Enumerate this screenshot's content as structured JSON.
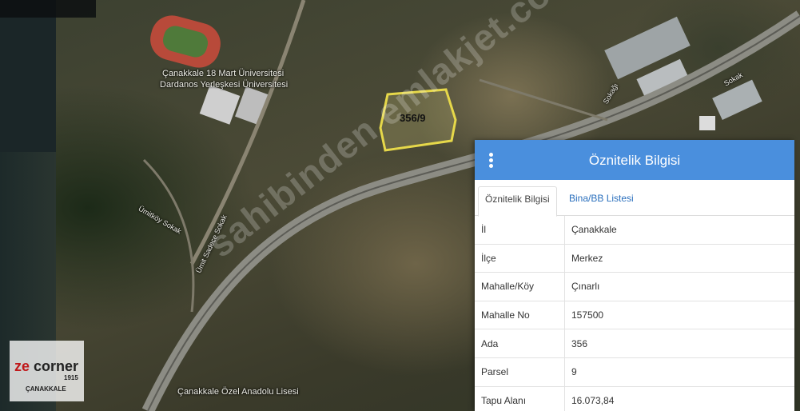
{
  "map": {
    "labels": {
      "university_line1": "Çanakkale 18 Mart Üniversitesi",
      "university_line2": "Dardanos Yerleşkesi Üniversitesi",
      "school": "Çanakkale Özel Anadolu Lisesi",
      "street1": "Ümitköy Sokak",
      "street2": "Ümit Sadece Sokak",
      "road1": "Sokak",
      "road2": "Sokağı"
    },
    "parcel_label": "356/9",
    "parcel_color": "#e6d84a",
    "watermark": "sahibinden emlakjet.com"
  },
  "logo": {
    "ze": "ze",
    "corner": "corner",
    "year": "1915",
    "city": "ÇANAKKALE"
  },
  "panel": {
    "title": "Öznitelik Bilgisi",
    "menu_icon": "vertical-dots-icon",
    "header_color": "#4a8fdd",
    "tabs": [
      {
        "label": "Öznitelik Bilgisi",
        "active": true
      },
      {
        "label": "Bina/BB Listesi",
        "active": false
      }
    ],
    "rows": [
      {
        "key": "İl",
        "value": "Çanakkale"
      },
      {
        "key": "İlçe",
        "value": "Merkez"
      },
      {
        "key": "Mahalle/Köy",
        "value": "Çınarlı"
      },
      {
        "key": "Mahalle No",
        "value": "157500"
      },
      {
        "key": "Ada",
        "value": "356"
      },
      {
        "key": "Parsel",
        "value": "9"
      },
      {
        "key": "Tapu Alanı",
        "value": "16.073,84"
      }
    ]
  }
}
